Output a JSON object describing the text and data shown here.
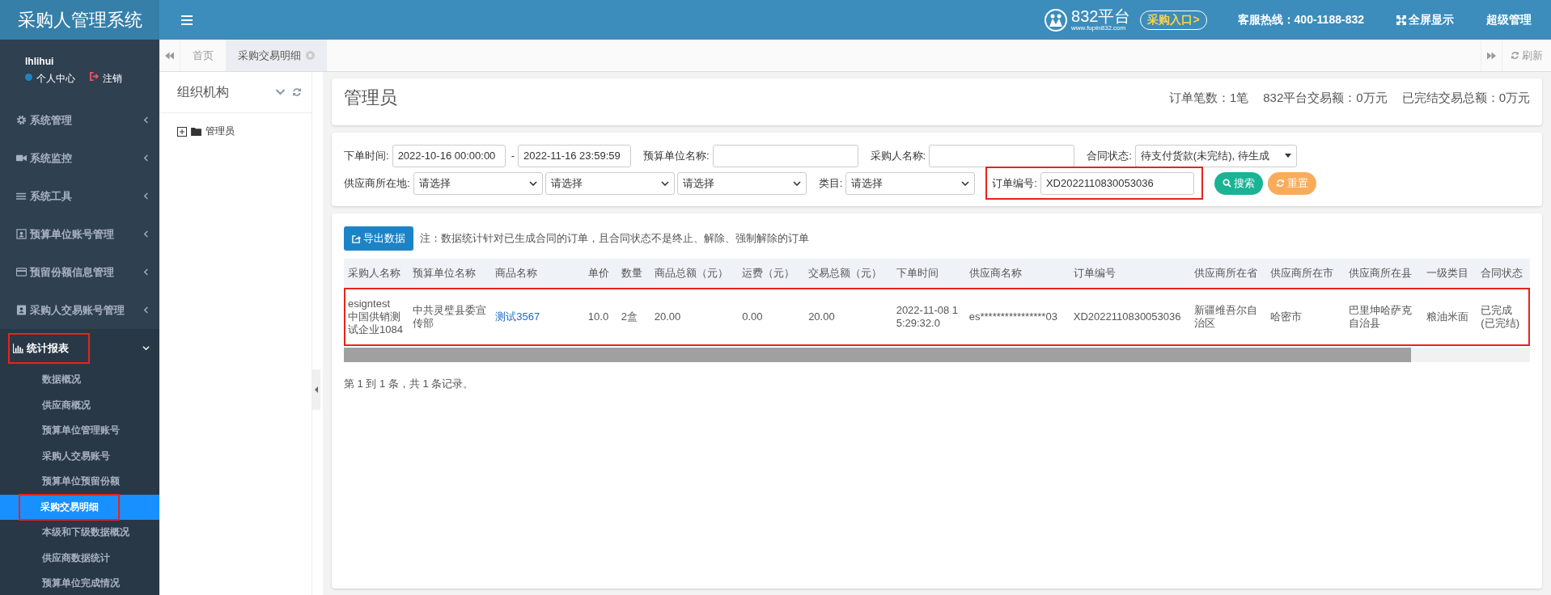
{
  "header": {
    "logo": "采购人管理系统",
    "brand": "832平台",
    "brand_url": "www.fupin832.com",
    "entry_button": "采购入口>",
    "hotline": "客服热线：400-1188-832",
    "fullscreen": "全屏显示",
    "user": "超级管理"
  },
  "sidebar": {
    "username": "lhlihui",
    "links": [
      {
        "kind": "profile",
        "label": "个人中心"
      },
      {
        "kind": "logout",
        "label": "注销"
      }
    ],
    "items": [
      {
        "label": "系统管理",
        "expanded": false,
        "highlighted": false
      },
      {
        "label": "系统监控",
        "expanded": false,
        "highlighted": false
      },
      {
        "label": "系统工具",
        "expanded": false,
        "highlighted": false
      },
      {
        "label": "预算单位账号管理",
        "expanded": false,
        "highlighted": false
      },
      {
        "label": "预留份额信息管理",
        "expanded": false,
        "highlighted": false
      },
      {
        "label": "采购人交易账号管理",
        "expanded": false,
        "highlighted": false
      },
      {
        "label": "统计报表",
        "expanded": true,
        "highlighted": true,
        "children": [
          {
            "label": "数据概况",
            "selected": false,
            "highlighted": false
          },
          {
            "label": "供应商概况",
            "selected": false,
            "highlighted": false
          },
          {
            "label": "预算单位管理账号",
            "selected": false,
            "highlighted": false
          },
          {
            "label": "采购人交易账号",
            "selected": false,
            "highlighted": false
          },
          {
            "label": "预算单位预留份额",
            "selected": false,
            "highlighted": false
          },
          {
            "label": "采购交易明细",
            "selected": true,
            "highlighted": true
          },
          {
            "label": "本级和下级数据概况",
            "selected": false,
            "highlighted": false
          },
          {
            "label": "供应商数据统计",
            "selected": false,
            "highlighted": false
          },
          {
            "label": "预算单位完成情况",
            "selected": false,
            "highlighted": false
          }
        ]
      }
    ]
  },
  "tabs": [
    {
      "label": "首页",
      "selected": false,
      "closable": false
    },
    {
      "label": "采购交易明细",
      "selected": true,
      "closable": true
    }
  ],
  "refresh": "刷新",
  "tree_panel": {
    "title": "组织机构",
    "nodes": [
      {
        "label": "管理员",
        "expanded": false
      }
    ]
  },
  "summary": {
    "title": "管理员",
    "stats": [
      "订单笔数：1笔",
      "832平台交易额：0万元",
      "已完结交易总额：0万元"
    ]
  },
  "filters": [
    [
      {
        "kind": "date-range",
        "label": "下单时间:",
        "values": [
          "2022-10-16 00:00:00",
          "2022-11-16 23:59:59"
        ],
        "separator": "-",
        "highlighted": false
      },
      {
        "kind": "text",
        "label": "预算单位名称:",
        "highlighted": false
      },
      {
        "kind": "text",
        "label": "采购人名称:",
        "highlighted": false
      },
      {
        "kind": "dropdown",
        "label": "合同状态:",
        "value": "待支付货款(未完结), 待生成",
        "highlighted": false
      }
    ],
    [
      {
        "kind": "select-group",
        "label": "供应商所在地:",
        "values": [
          "请选择",
          "请选择",
          "请选择"
        ],
        "highlighted": false
      },
      {
        "kind": "select",
        "label": "类目:",
        "value": "请选择",
        "highlighted": false
      },
      {
        "kind": "text",
        "label": "订单编号:",
        "value": "XD2022110830053036",
        "highlighted": true
      }
    ]
  ],
  "buttons": [
    {
      "kind": "search",
      "label": "搜索"
    },
    {
      "kind": "reset",
      "label": "重置"
    }
  ],
  "export_button": "导出数据",
  "note": "注：数据统计针对已生成合同的订单，且合同状态不是终止、解除、强制解除的订单",
  "table": {
    "columns": [
      "采购人名称",
      "预算单位名称",
      "商品名称",
      "单价",
      "数量",
      "商品总额（元）",
      "运费（元）",
      "交易总额（元）",
      "下单时间",
      "供应商名称",
      "订单编号",
      "供应商所在省",
      "供应商所在市",
      "供应商所在县",
      "一级类目",
      "合同状态"
    ],
    "rows": [
      {
        "highlighted": true,
        "cells": [
          {
            "text": "esigntest\n中国供销测试企业1084",
            "link": false
          },
          {
            "text": "中共灵璧县委宣传部",
            "link": false
          },
          {
            "text": "测试3567",
            "link": true
          },
          {
            "text": "10.0",
            "link": false
          },
          {
            "text": "2盒",
            "link": false
          },
          {
            "text": "20.00",
            "link": false
          },
          {
            "text": "0.00",
            "link": false
          },
          {
            "text": "20.00",
            "link": false
          },
          {
            "text": "2022-11-08 15:29:32.0",
            "link": false
          },
          {
            "text": "es****************03",
            "link": false
          },
          {
            "text": "XD2022110830053036",
            "link": false
          },
          {
            "text": "新疆维吾尔自治区",
            "link": false
          },
          {
            "text": "哈密市",
            "link": false
          },
          {
            "text": "巴里坤哈萨克自治县",
            "link": false
          },
          {
            "text": "粮油米面",
            "link": false
          },
          {
            "text": "已完成(已完结)",
            "link": false
          }
        ]
      }
    ]
  },
  "pagination": "第 1 到 1 条，共 1 条记录。"
}
